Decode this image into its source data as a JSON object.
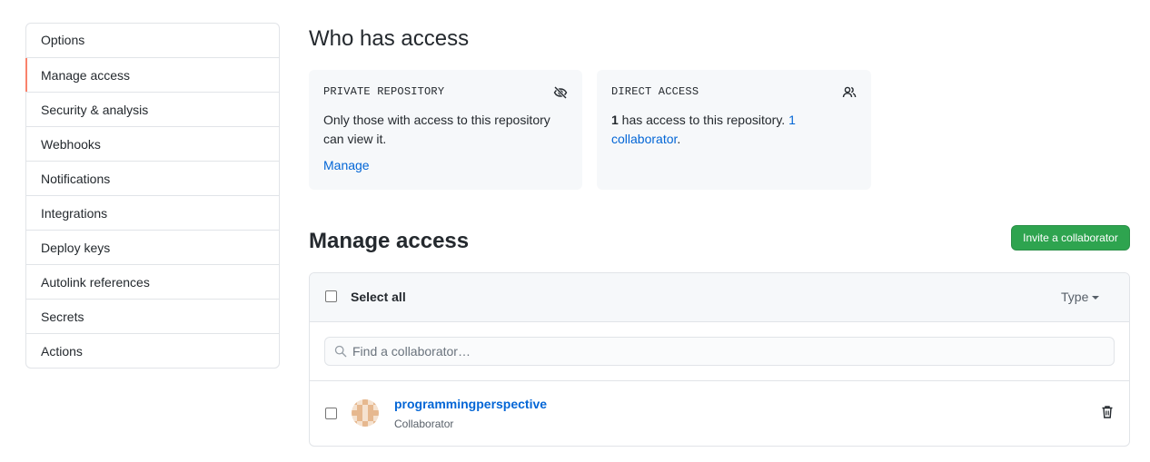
{
  "sidebar": {
    "items": [
      {
        "label": "Options"
      },
      {
        "label": "Manage access"
      },
      {
        "label": "Security & analysis"
      },
      {
        "label": "Webhooks"
      },
      {
        "label": "Notifications"
      },
      {
        "label": "Integrations"
      },
      {
        "label": "Deploy keys"
      },
      {
        "label": "Autolink references"
      },
      {
        "label": "Secrets"
      },
      {
        "label": "Actions"
      }
    ],
    "active_index": 1,
    "active_accent": "#f9826c"
  },
  "who_has_access": {
    "title": "Who has access",
    "private_card": {
      "title": "Private repository",
      "icon": "eye-closed-icon",
      "text": "Only those with access to this repository can view it.",
      "link": "Manage"
    },
    "direct_card": {
      "title": "Direct access",
      "icon": "people-icon",
      "count": "1",
      "text": " has access to this repository. ",
      "link": "1 collaborator",
      "suffix": "."
    }
  },
  "manage_access": {
    "title": "Manage access",
    "invite_button": "Invite a collaborator",
    "select_all": "Select all",
    "type_filter": "Type",
    "search_placeholder": "Find a collaborator…",
    "members": [
      {
        "name": "programmingperspective",
        "role": "Collaborator",
        "avatar": "identicon"
      }
    ]
  },
  "colors": {
    "link": "#0366d6",
    "primary_button": "#2ea44f",
    "card_bg": "#f6f8fa"
  }
}
